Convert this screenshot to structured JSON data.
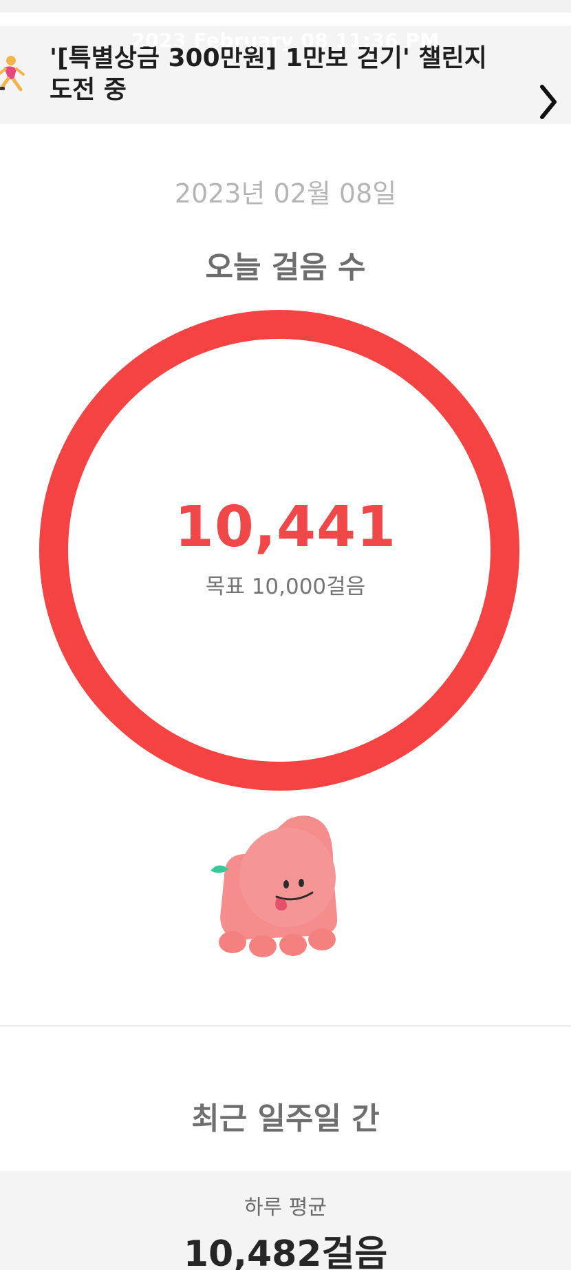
{
  "overlay": {
    "timestamp": "2023 February 08 11:36 PM"
  },
  "banner": {
    "icon": "running-person-icon",
    "text": "'[특별상금 300만원] 1만보 걷기' 챌린지 도전 중",
    "chevron_icon": "chevron-right-icon"
  },
  "today": {
    "date": "2023년 02월 08일",
    "title": "오늘 걸음 수",
    "steps": "10,441",
    "goal": "목표 10,000걸음",
    "progress_fraction": 1.0,
    "ring_color": "#f54343"
  },
  "character": {
    "icon": "peach-character-illustration"
  },
  "week": {
    "title": "최근 일주일 간",
    "avg_label": "하루 평균",
    "avg_value": "10,482걸음"
  }
}
